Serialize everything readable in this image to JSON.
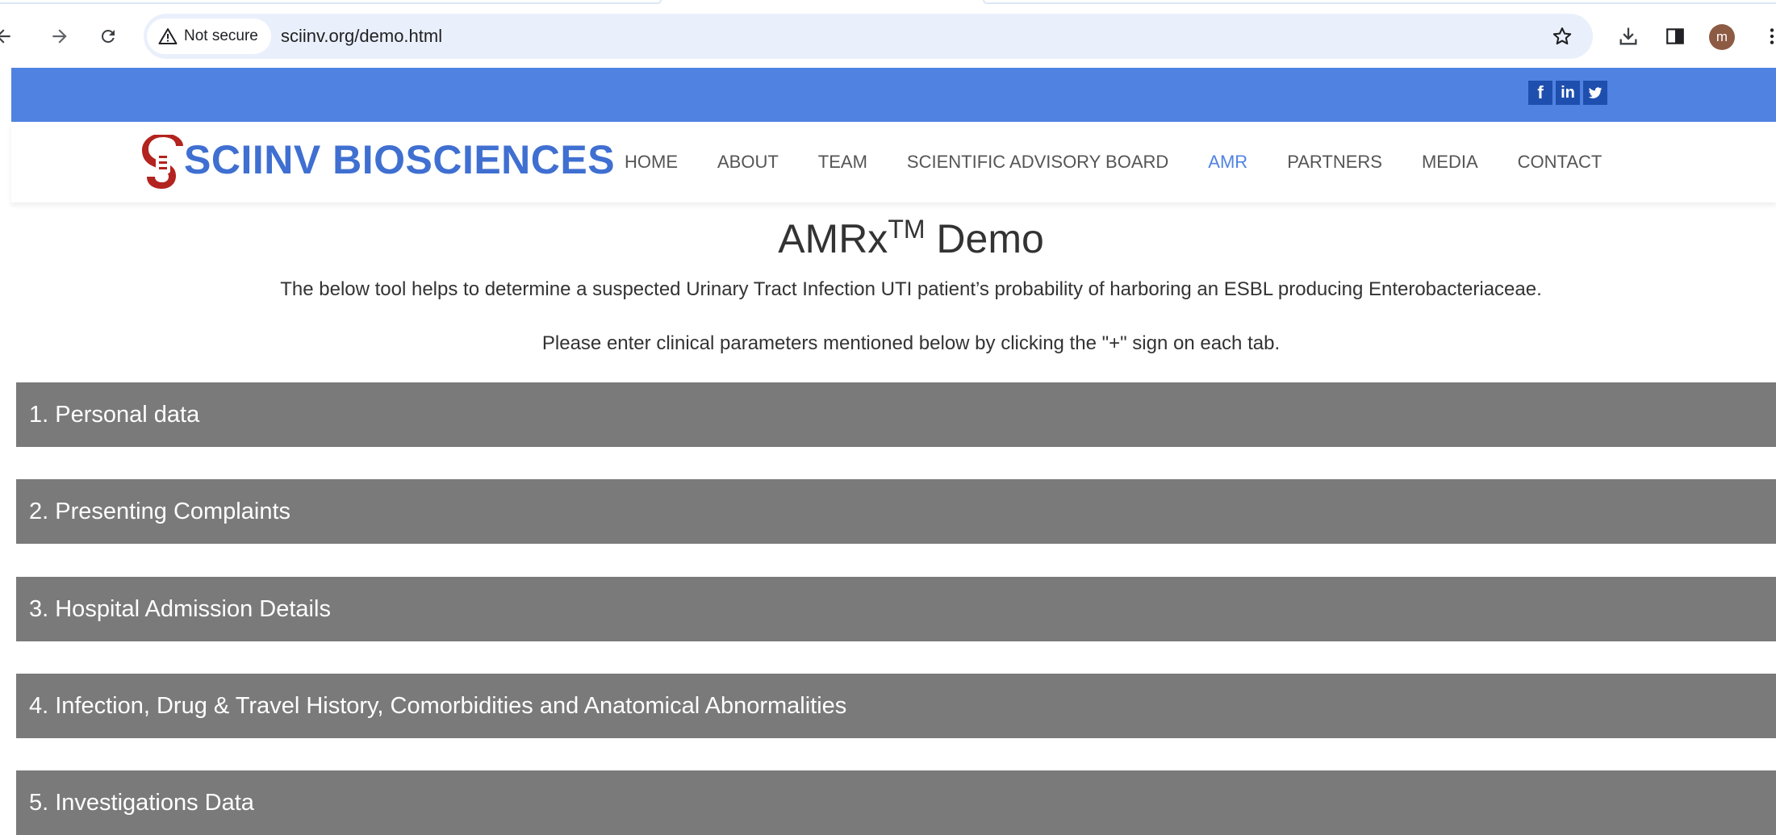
{
  "browser": {
    "security_label": "Not secure",
    "url": "sciinv.org/demo.html",
    "profile_initial": "m"
  },
  "social": {
    "facebook": "f",
    "linkedin": "in",
    "twitter": "t"
  },
  "site": {
    "logo_text": "SCIINV BIOSCIENCES",
    "brand_color": "#3f6fd1",
    "menu": [
      {
        "label": "HOME"
      },
      {
        "label": "ABOUT"
      },
      {
        "label": "TEAM"
      },
      {
        "label": "SCIENTIFIC ADVISORY BOARD"
      },
      {
        "label": "AMR"
      },
      {
        "label": "PARTNERS"
      },
      {
        "label": "MEDIA"
      },
      {
        "label": "CONTACT"
      }
    ],
    "active_menu": "AMR"
  },
  "main": {
    "title_main": "AMRx",
    "title_sup": "TM",
    "title_rest": " Demo",
    "intro": "The below tool helps to determine a suspected Urinary Tract Infection UTI patient’s probability of harboring an ESBL producing Enterobacteriaceae.",
    "instructions": "Please enter clinical parameters mentioned below by clicking the \"+\" sign on each tab.",
    "sections": [
      {
        "label": "1. Personal data"
      },
      {
        "label": "2. Presenting Complaints"
      },
      {
        "label": "3. Hospital Admission Details"
      },
      {
        "label": "4. Infection, Drug & Travel History, Comorbidities and Anatomical Abnormalities"
      },
      {
        "label": "5. Investigations Data"
      }
    ]
  }
}
